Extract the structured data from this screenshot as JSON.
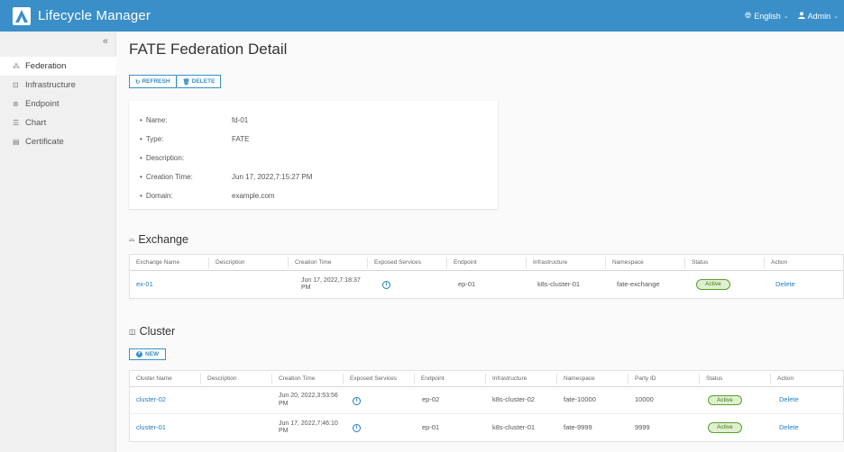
{
  "app": {
    "title": "Lifecycle Manager",
    "language": "English",
    "user": "Admin"
  },
  "sidebar": {
    "collapse_icon": "«",
    "items": [
      {
        "label": "Federation",
        "icon": "federation-icon",
        "active": true
      },
      {
        "label": "Infrastructure",
        "icon": "infrastructure-icon"
      },
      {
        "label": "Endpoint",
        "icon": "endpoint-icon"
      },
      {
        "label": "Chart",
        "icon": "chart-icon"
      },
      {
        "label": "Certificate",
        "icon": "certificate-icon"
      }
    ]
  },
  "page": {
    "title": "FATE Federation Detail",
    "refresh_label": "REFRESH",
    "delete_label": "DELETE"
  },
  "details": [
    {
      "label": "Name:",
      "value": "fd-01"
    },
    {
      "label": "Type:",
      "value": "FATE"
    },
    {
      "label": "Description:",
      "value": ""
    },
    {
      "label": "Creation Time:",
      "value": "Jun 17, 2022,7:15:27 PM"
    },
    {
      "label": "Domain:",
      "value": "example.com"
    }
  ],
  "exchange": {
    "title": "Exchange",
    "headers": [
      "Exchange Name",
      "Description",
      "Creation Time",
      "Exposed Services",
      "Endpoint",
      "Infrastructure",
      "Namespace",
      "Status",
      "Action"
    ],
    "rows": [
      {
        "name": "ex-01",
        "description": "",
        "creation_time": "Jun 17, 2022,7:18:37 PM",
        "endpoint": "ep-01",
        "infrastructure": "k8s-cluster-01",
        "namespace": "fate-exchange",
        "status": "Active",
        "action": "Delete"
      }
    ]
  },
  "cluster": {
    "title": "Cluster",
    "new_label": "NEW",
    "headers": [
      "Cluster Name",
      "Description",
      "Creation Time",
      "Exposed Services",
      "Endpoint",
      "Infrastructure",
      "Namespace",
      "Party ID",
      "Status",
      "Action"
    ],
    "rows": [
      {
        "name": "cluster-02",
        "description": "",
        "creation_time": "Jun 20, 2022,3:53:56 PM",
        "endpoint": "ep-02",
        "infrastructure": "k8s-cluster-02",
        "namespace": "fate-10000",
        "party_id": "10000",
        "status": "Active",
        "action": "Delete"
      },
      {
        "name": "cluster-01",
        "description": "",
        "creation_time": "Jun 17, 2022,7:46:10 PM",
        "endpoint": "ep-01",
        "infrastructure": "k8s-cluster-01",
        "namespace": "fate-9999",
        "party_id": "9999",
        "status": "Active",
        "action": "Delete"
      }
    ]
  },
  "colors": {
    "header": "#3a8fc8",
    "link": "#1f7ec1",
    "active_badge": "#5aa02c"
  }
}
